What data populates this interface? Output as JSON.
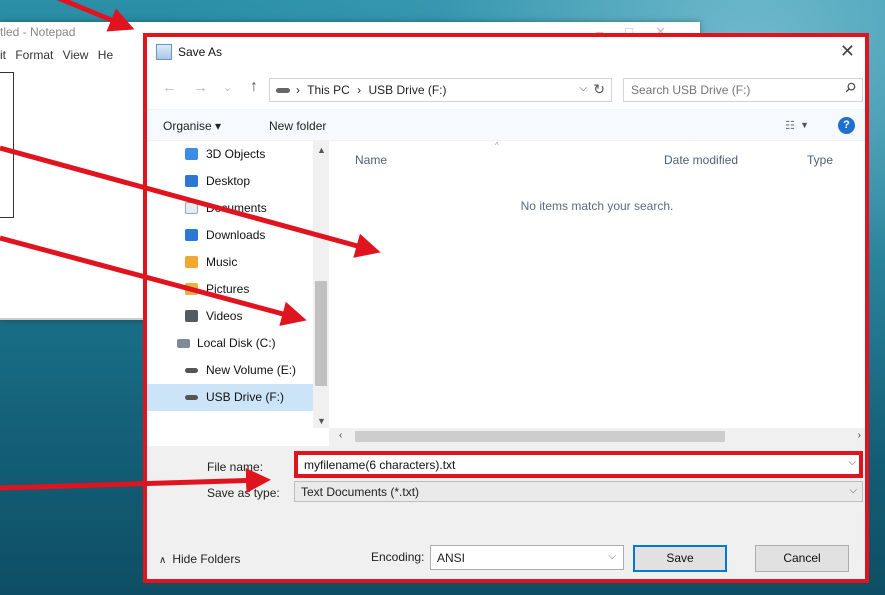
{
  "notepad": {
    "title": "tled - Notepad",
    "menu": "it  Format  View  He"
  },
  "dialog": {
    "title": "Save As",
    "close_glyph": "✕",
    "nav": {
      "back_glyph": "←",
      "forward_glyph": "→",
      "recent_glyph": "⌄",
      "up_glyph": "↑",
      "crumbs": [
        "This PC",
        "USB Drive (F:)"
      ],
      "crumb_sep": "›",
      "search_placeholder": "Search USB Drive (F:)"
    },
    "commands": {
      "organise": "Organise ▾",
      "new_folder": "New folder",
      "help": "?"
    },
    "sidebar": {
      "items": [
        {
          "label": "3D Objects",
          "icon": "3d-objects-icon",
          "color": "#3a8ee6"
        },
        {
          "label": "Desktop",
          "icon": "desktop-icon",
          "color": "#2b78d4"
        },
        {
          "label": "Documents",
          "icon": "documents-icon",
          "color": "#9aa6b2"
        },
        {
          "label": "Downloads",
          "icon": "downloads-icon",
          "color": "#2b78d4"
        },
        {
          "label": "Music",
          "icon": "music-icon",
          "color": "#f0a830"
        },
        {
          "label": "Pictures",
          "icon": "pictures-icon",
          "color": "#e8b040"
        },
        {
          "label": "Videos",
          "icon": "videos-icon",
          "color": "#555a60"
        },
        {
          "label": "Local Disk (C:)",
          "icon": "local-disk-icon",
          "color": "#7c8a99"
        },
        {
          "label": "New Volume (E:)",
          "icon": "drive-icon",
          "color": "#555"
        },
        {
          "label": "USB Drive (F:)",
          "icon": "usb-drive-icon",
          "color": "#555",
          "selected": true
        }
      ]
    },
    "columns": {
      "name": "Name",
      "date": "Date modified",
      "type": "Type"
    },
    "empty_message": "No items match your search.",
    "filename": {
      "label": "File name:",
      "value": "myfilename(6 characters).txt"
    },
    "save_type": {
      "label": "Save as type:",
      "value": "Text Documents (*.txt)"
    },
    "hide_folders": "Hide Folders",
    "encoding": {
      "label": "Encoding:",
      "value": "ANSI"
    },
    "buttons": {
      "save": "Save",
      "cancel": "Cancel"
    }
  },
  "colors": {
    "annotation_red": "#e0141e",
    "selection_blue": "#cce4f7",
    "accent_blue": "#0078d7"
  }
}
